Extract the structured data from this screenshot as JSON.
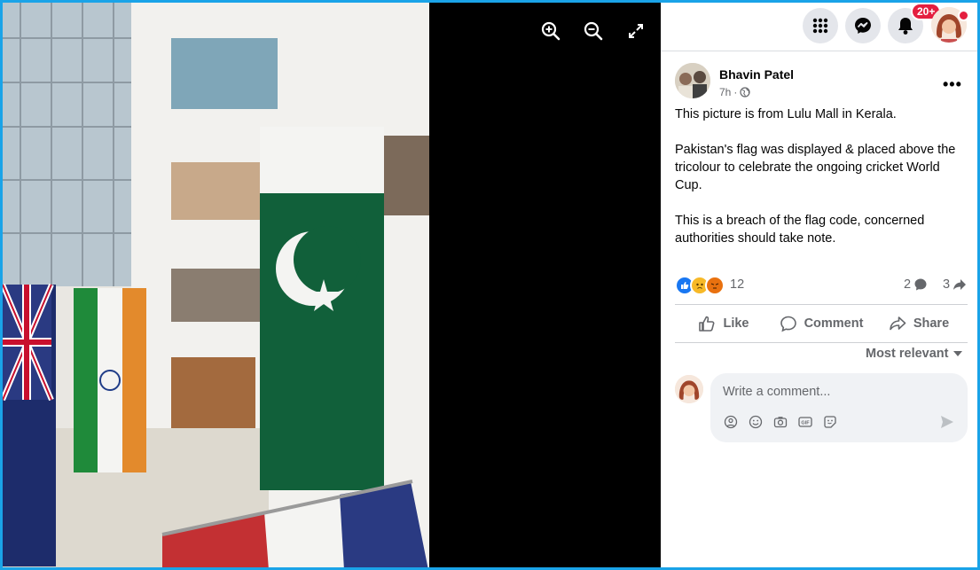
{
  "viewer": {
    "tools": {
      "zoom_in": "zoom-in-icon",
      "zoom_out": "zoom-out-icon",
      "fullscreen": "fullscreen-icon"
    }
  },
  "topbar": {
    "menu_icon": "apps-grid-icon",
    "messenger_icon": "messenger-icon",
    "notifications_icon": "bell-icon",
    "notification_badge": "20+"
  },
  "post": {
    "author": "Bhavin Patel",
    "time": "7h",
    "visibility_icon": "globe-icon",
    "paragraphs": [
      "This picture is from Lulu Mall in Kerala.",
      "Pakistan's flag was displayed & placed above the tricolour to celebrate the ongoing cricket World Cup.",
      "This is a breach of the flag code, concerned authorities should take note."
    ],
    "reaction_count": "12",
    "comment_count": "2",
    "share_count": "3"
  },
  "actions": {
    "like": "Like",
    "comment": "Comment",
    "share": "Share"
  },
  "sort_label": "Most relevant",
  "comment_box": {
    "placeholder": "Write a comment..."
  },
  "colors": {
    "accent": "#1877f2",
    "border": "#1aa3e8",
    "badge": "#e41e3f"
  }
}
